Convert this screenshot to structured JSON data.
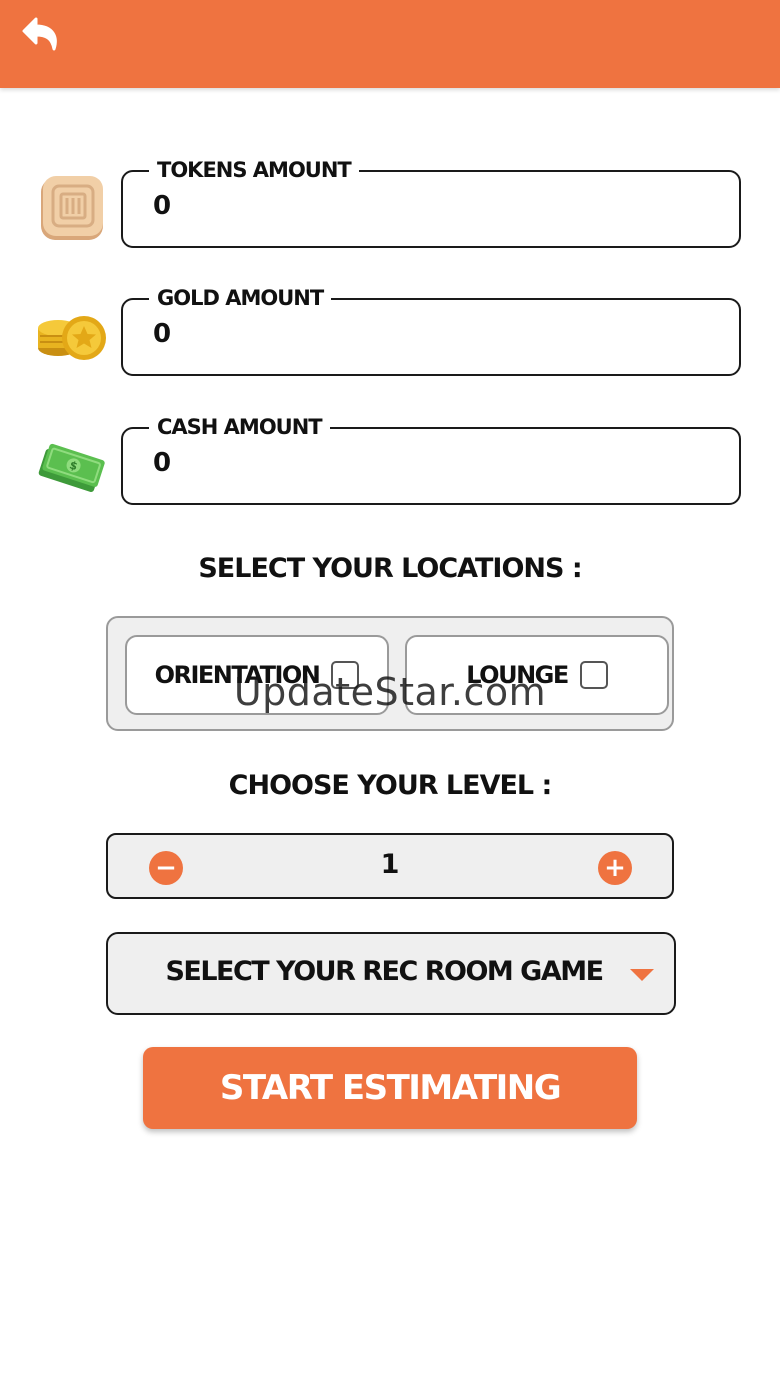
{
  "colors": {
    "accent": "#ef7340"
  },
  "header": {
    "back_icon": "back-arrow-icon"
  },
  "fields": [
    {
      "label": "TOKENS AMOUNT",
      "value": "0",
      "icon": "token-icon"
    },
    {
      "label": "GOLD AMOUNT",
      "value": "0",
      "icon": "gold-coins-icon"
    },
    {
      "label": "CASH AMOUNT",
      "value": "0",
      "icon": "cash-icon"
    }
  ],
  "locations": {
    "title": "SELECT YOUR LOCATIONS :",
    "options": [
      {
        "label": "ORIENTATION",
        "checked": false
      },
      {
        "label": "LOUNGE",
        "checked": false
      }
    ]
  },
  "level": {
    "title": "CHOOSE YOUR LEVEL :",
    "value": "1",
    "decrement": "−",
    "increment": "+"
  },
  "game_select": {
    "label": "SELECT YOUR REC ROOM GAME"
  },
  "start_button": {
    "label": "START ESTIMATING"
  },
  "watermark": "UpdateStar.com"
}
